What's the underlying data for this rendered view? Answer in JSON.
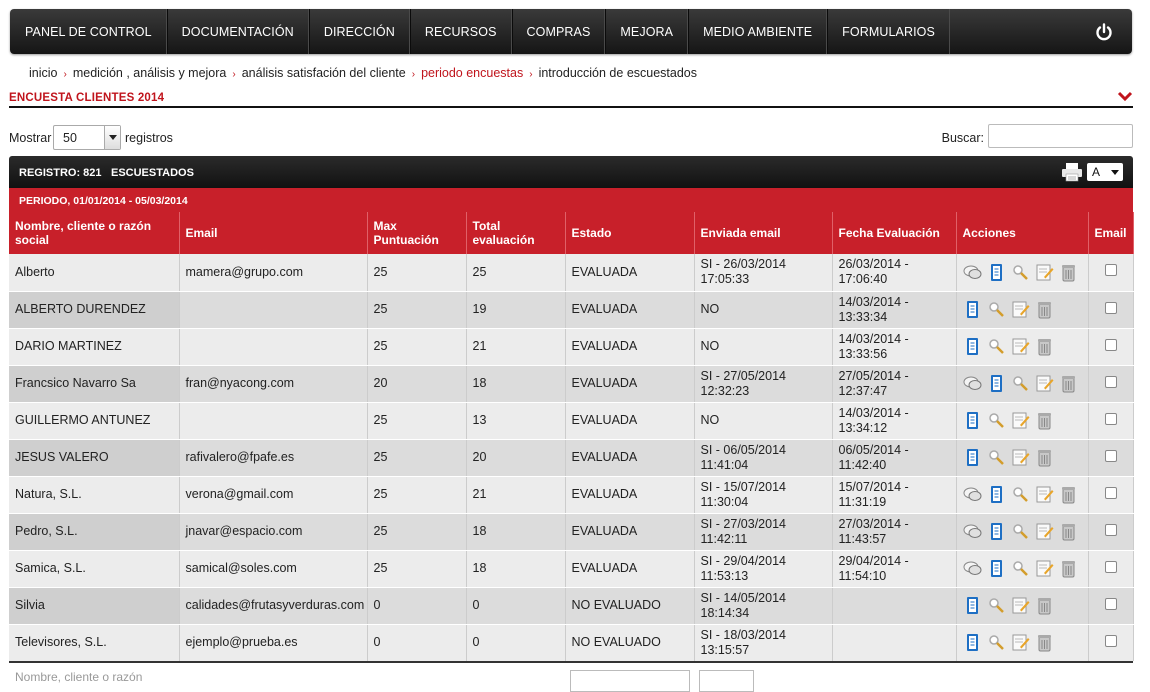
{
  "nav": {
    "items": [
      "PANEL DE CONTROL",
      "DOCUMENTACIÓN",
      "DIRECCIÓN",
      "RECURSOS",
      "COMPRAS",
      "MEJORA",
      "MEDIO AMBIENTE",
      "FORMULARIOS"
    ],
    "power_icon": "power-icon"
  },
  "breadcrumb": {
    "items": [
      "inicio",
      "medición , análisis y mejora",
      "análisis satisfación del cliente",
      "periodo encuestas",
      "introducción de escuestados"
    ],
    "active_index": 3,
    "separator": "›"
  },
  "section": {
    "title": "ENCUESTA CLIENTES 2014"
  },
  "controls": {
    "show_label": "Mostrar",
    "page_size": "50",
    "records_label": "registros",
    "search_label": "Buscar:",
    "search_value": ""
  },
  "tablebar": {
    "registro": "REGISTRO: 821",
    "tipo": "ESCUESTADOS",
    "format": "A"
  },
  "period": {
    "label": "PERIODO, 01/01/2014 - 05/03/2014"
  },
  "columns": [
    "Nombre, cliente o razón social",
    "Email",
    "Max Puntuación",
    "Total evaluación",
    "Estado",
    "Enviada email",
    "Fecha Evaluación",
    "Acciones",
    "Email"
  ],
  "rows": [
    {
      "name": "Alberto",
      "email": "mamera@grupo.com",
      "max": "25",
      "total": "25",
      "estado": "EVALUADA",
      "enviada": "SI - 26/03/2014 17:05:33",
      "fecha": "26/03/2014 - 17:06:40",
      "chat": true
    },
    {
      "name": "ALBERTO DURENDEZ",
      "email": "",
      "max": "25",
      "total": "19",
      "estado": "EVALUADA",
      "enviada": "NO",
      "fecha": "14/03/2014 - 13:33:34",
      "chat": false
    },
    {
      "name": "DARIO MARTINEZ",
      "email": "",
      "max": "25",
      "total": "21",
      "estado": "EVALUADA",
      "enviada": "NO",
      "fecha": "14/03/2014 - 13:33:56",
      "chat": false
    },
    {
      "name": "Francsico Navarro Sa",
      "email": "fran@nyacong.com",
      "max": "20",
      "total": "18",
      "estado": "EVALUADA",
      "enviada": "SI - 27/05/2014 12:32:23",
      "fecha": "27/05/2014 - 12:37:47",
      "chat": true
    },
    {
      "name": "GUILLERMO ANTUNEZ",
      "email": "",
      "max": "25",
      "total": "13",
      "estado": "EVALUADA",
      "enviada": "NO",
      "fecha": "14/03/2014 - 13:34:12",
      "chat": false
    },
    {
      "name": "JESUS VALERO",
      "email": "rafivalero@fpafe.es",
      "max": "25",
      "total": "20",
      "estado": "EVALUADA",
      "enviada": "SI - 06/05/2014 11:41:04",
      "fecha": "06/05/2014 - 11:42:40",
      "chat": false
    },
    {
      "name": "Natura, S.L.",
      "email": "verona@gmail.com",
      "max": "25",
      "total": "21",
      "estado": "EVALUADA",
      "enviada": "SI - 15/07/2014 11:30:04",
      "fecha": "15/07/2014 - 11:31:19",
      "chat": true
    },
    {
      "name": "Pedro, S.L.",
      "email": "jnavar@espacio.com",
      "max": "25",
      "total": "18",
      "estado": "EVALUADA",
      "enviada": "SI - 27/03/2014 11:42:11",
      "fecha": "27/03/2014 - 11:43:57",
      "chat": true
    },
    {
      "name": "Samica, S.L.",
      "email": "samical@soles.com",
      "max": "25",
      "total": "18",
      "estado": "EVALUADA",
      "enviada": "SI - 29/04/2014 11:53:13",
      "fecha": "29/04/2014 - 11:54:10",
      "chat": true
    },
    {
      "name": "Silvia",
      "email": "calidades@frutasyverduras.com",
      "max": "0",
      "total": "0",
      "estado": "NO EVALUADO",
      "enviada": "SI - 14/05/2014 18:14:34",
      "fecha": "",
      "chat": false
    },
    {
      "name": "Televisores, S.L.",
      "email": "ejemplo@prueba.es",
      "max": "0",
      "total": "0",
      "estado": "NO EVALUADO",
      "enviada": "SI - 18/03/2014 13:15:57",
      "fecha": "",
      "chat": false
    }
  ],
  "filter": {
    "name_label": "Nombre, cliente o razón"
  },
  "colors": {
    "accent": "#c8202a",
    "nav_bg": "#1f1f1f"
  }
}
